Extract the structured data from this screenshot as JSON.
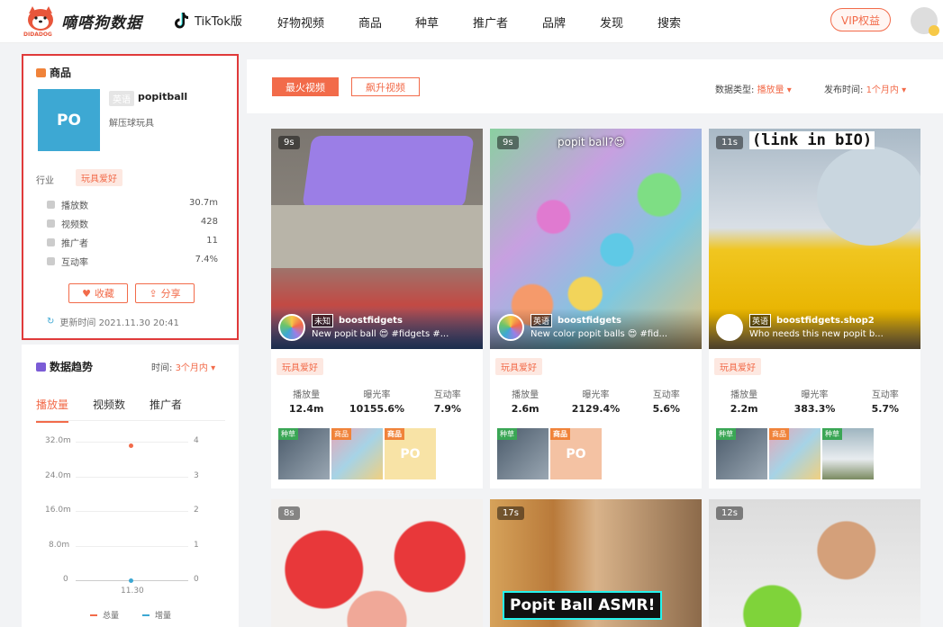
{
  "nav": {
    "brand": "嘀嗒狗数据",
    "brand_sub": "DIDADOG",
    "tiktok": "TikTok版",
    "items": [
      "好物视频",
      "商品",
      "种草",
      "推广者",
      "品牌",
      "发现",
      "搜索"
    ],
    "vip": "VIP权益"
  },
  "product": {
    "section_title": "商品",
    "thumb_text": "PO",
    "lang_tag": "英语",
    "name": "popitball",
    "desc": "解压球玩具",
    "industry_label": "行业",
    "industry_tag": "玩具爱好",
    "stats": [
      {
        "label": "播放数",
        "value": "30.7m"
      },
      {
        "label": "视频数",
        "value": "428"
      },
      {
        "label": "推广者",
        "value": "11"
      },
      {
        "label": "互动率",
        "value": "7.4%"
      }
    ],
    "fav_btn": "收藏",
    "share_btn": "分享",
    "updated": "更新时间 2021.11.30 20:41"
  },
  "trend": {
    "title": "数据趋势",
    "time_label": "时间:",
    "time_value": "3个月内",
    "tabs": [
      "播放量",
      "视频数",
      "推广者"
    ],
    "y_left": [
      "32.0m",
      "24.0m",
      "16.0m",
      "8.0m",
      "0"
    ],
    "y_right": [
      "4",
      "3",
      "2",
      "1",
      "0"
    ],
    "x_label": "11.30",
    "legend": [
      "总量",
      "增量"
    ]
  },
  "feed": {
    "tab_hot": "最火视频",
    "tab_rise": "飙升视频",
    "type_label": "数据类型:",
    "type_value": "播放量",
    "pub_label": "发布时间:",
    "pub_value": "1个月内",
    "metric_labels": [
      "播放量",
      "曝光率",
      "互动率"
    ],
    "cards": [
      {
        "dur": "9s",
        "lang": "未知",
        "author": "boostfidgets",
        "desc": "New popit ball 😍 #fidgets #...",
        "tag": "玩具爱好",
        "views": "12.4m",
        "exposure": "10155.6%",
        "engage": "7.9%",
        "p1": "种草",
        "p2": "商品",
        "p3": "商品",
        "p3text": "PO"
      },
      {
        "dur": "9s",
        "lang": "英语",
        "author": "boostfidgets",
        "desc": "New color popit balls 😍 #fid...",
        "tag": "玩具爱好",
        "overlay": "popit ball?😍",
        "views": "2.6m",
        "exposure": "2129.4%",
        "engage": "5.6%",
        "p1": "种草",
        "p2": "商品",
        "p2text": "PO"
      },
      {
        "dur": "11s",
        "lang": "英语",
        "author": "boostfidgets.shop2",
        "desc": "Who needs this new popit b...",
        "tag": "玩具爱好",
        "overlay": "(link in bIO)",
        "views": "2.2m",
        "exposure": "383.3%",
        "engage": "5.7%",
        "p1": "种草",
        "p2": "商品",
        "p3": "种草"
      }
    ],
    "bottom_cards": [
      {
        "dur": "8s"
      },
      {
        "dur": "17s",
        "overlay": "Popit Ball ASMR!"
      },
      {
        "dur": "12s"
      }
    ]
  }
}
